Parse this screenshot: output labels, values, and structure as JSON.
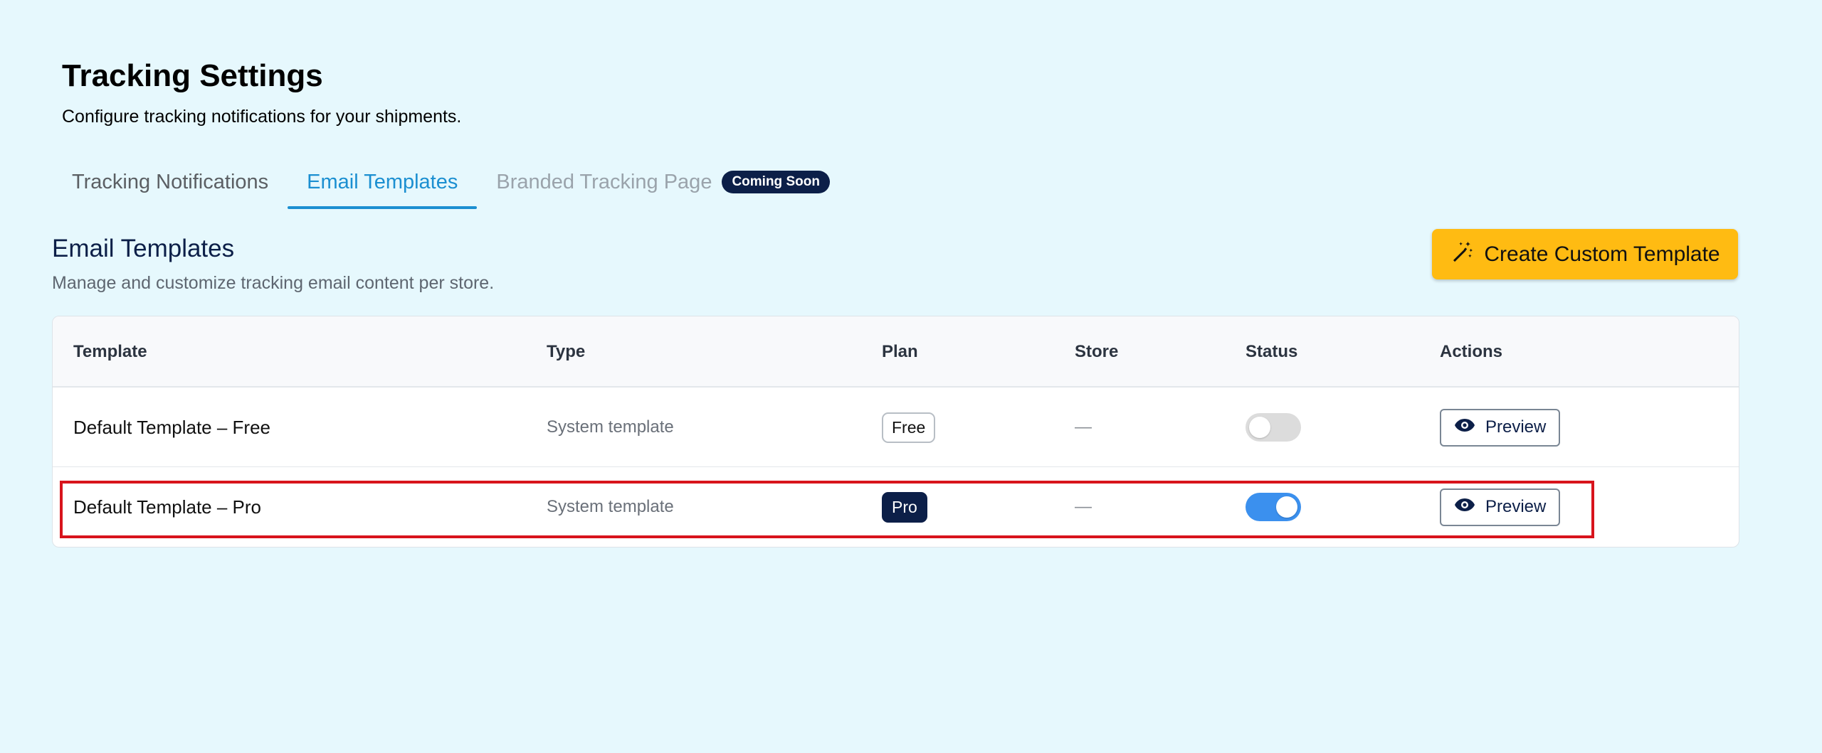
{
  "header": {
    "title": "Tracking Settings",
    "subtitle": "Configure tracking notifications for your shipments."
  },
  "tabs": [
    {
      "label": "Tracking Notifications",
      "state": "default"
    },
    {
      "label": "Email Templates",
      "state": "active"
    },
    {
      "label": "Branded Tracking Page",
      "state": "disabled",
      "badge": "Coming Soon"
    }
  ],
  "section": {
    "title": "Email Templates",
    "subtitle": "Manage and customize tracking email content per store.",
    "create_button_label": "Create Custom Template",
    "create_button_icon": "magic-wand-icon"
  },
  "table": {
    "headers": {
      "template": "Template",
      "type": "Type",
      "plan": "Plan",
      "store": "Store",
      "status": "Status",
      "actions": "Actions"
    },
    "rows": [
      {
        "template": "Default Template – Free",
        "type": "System template",
        "plan": "Free",
        "store": "—",
        "status_enabled": false,
        "action_label": "Preview"
      },
      {
        "template": "Default Template – Pro",
        "type": "System template",
        "plan": "Pro",
        "store": "—",
        "status_enabled": true,
        "action_label": "Preview",
        "highlighted": true
      }
    ]
  },
  "colors": {
    "background": "#e6f8fd",
    "accent_tab": "#1b8fd1",
    "primary_button": "#ffbb12",
    "navy": "#0c1f48",
    "toggle_on": "#3b90ee",
    "highlight_border": "#d8141c"
  }
}
